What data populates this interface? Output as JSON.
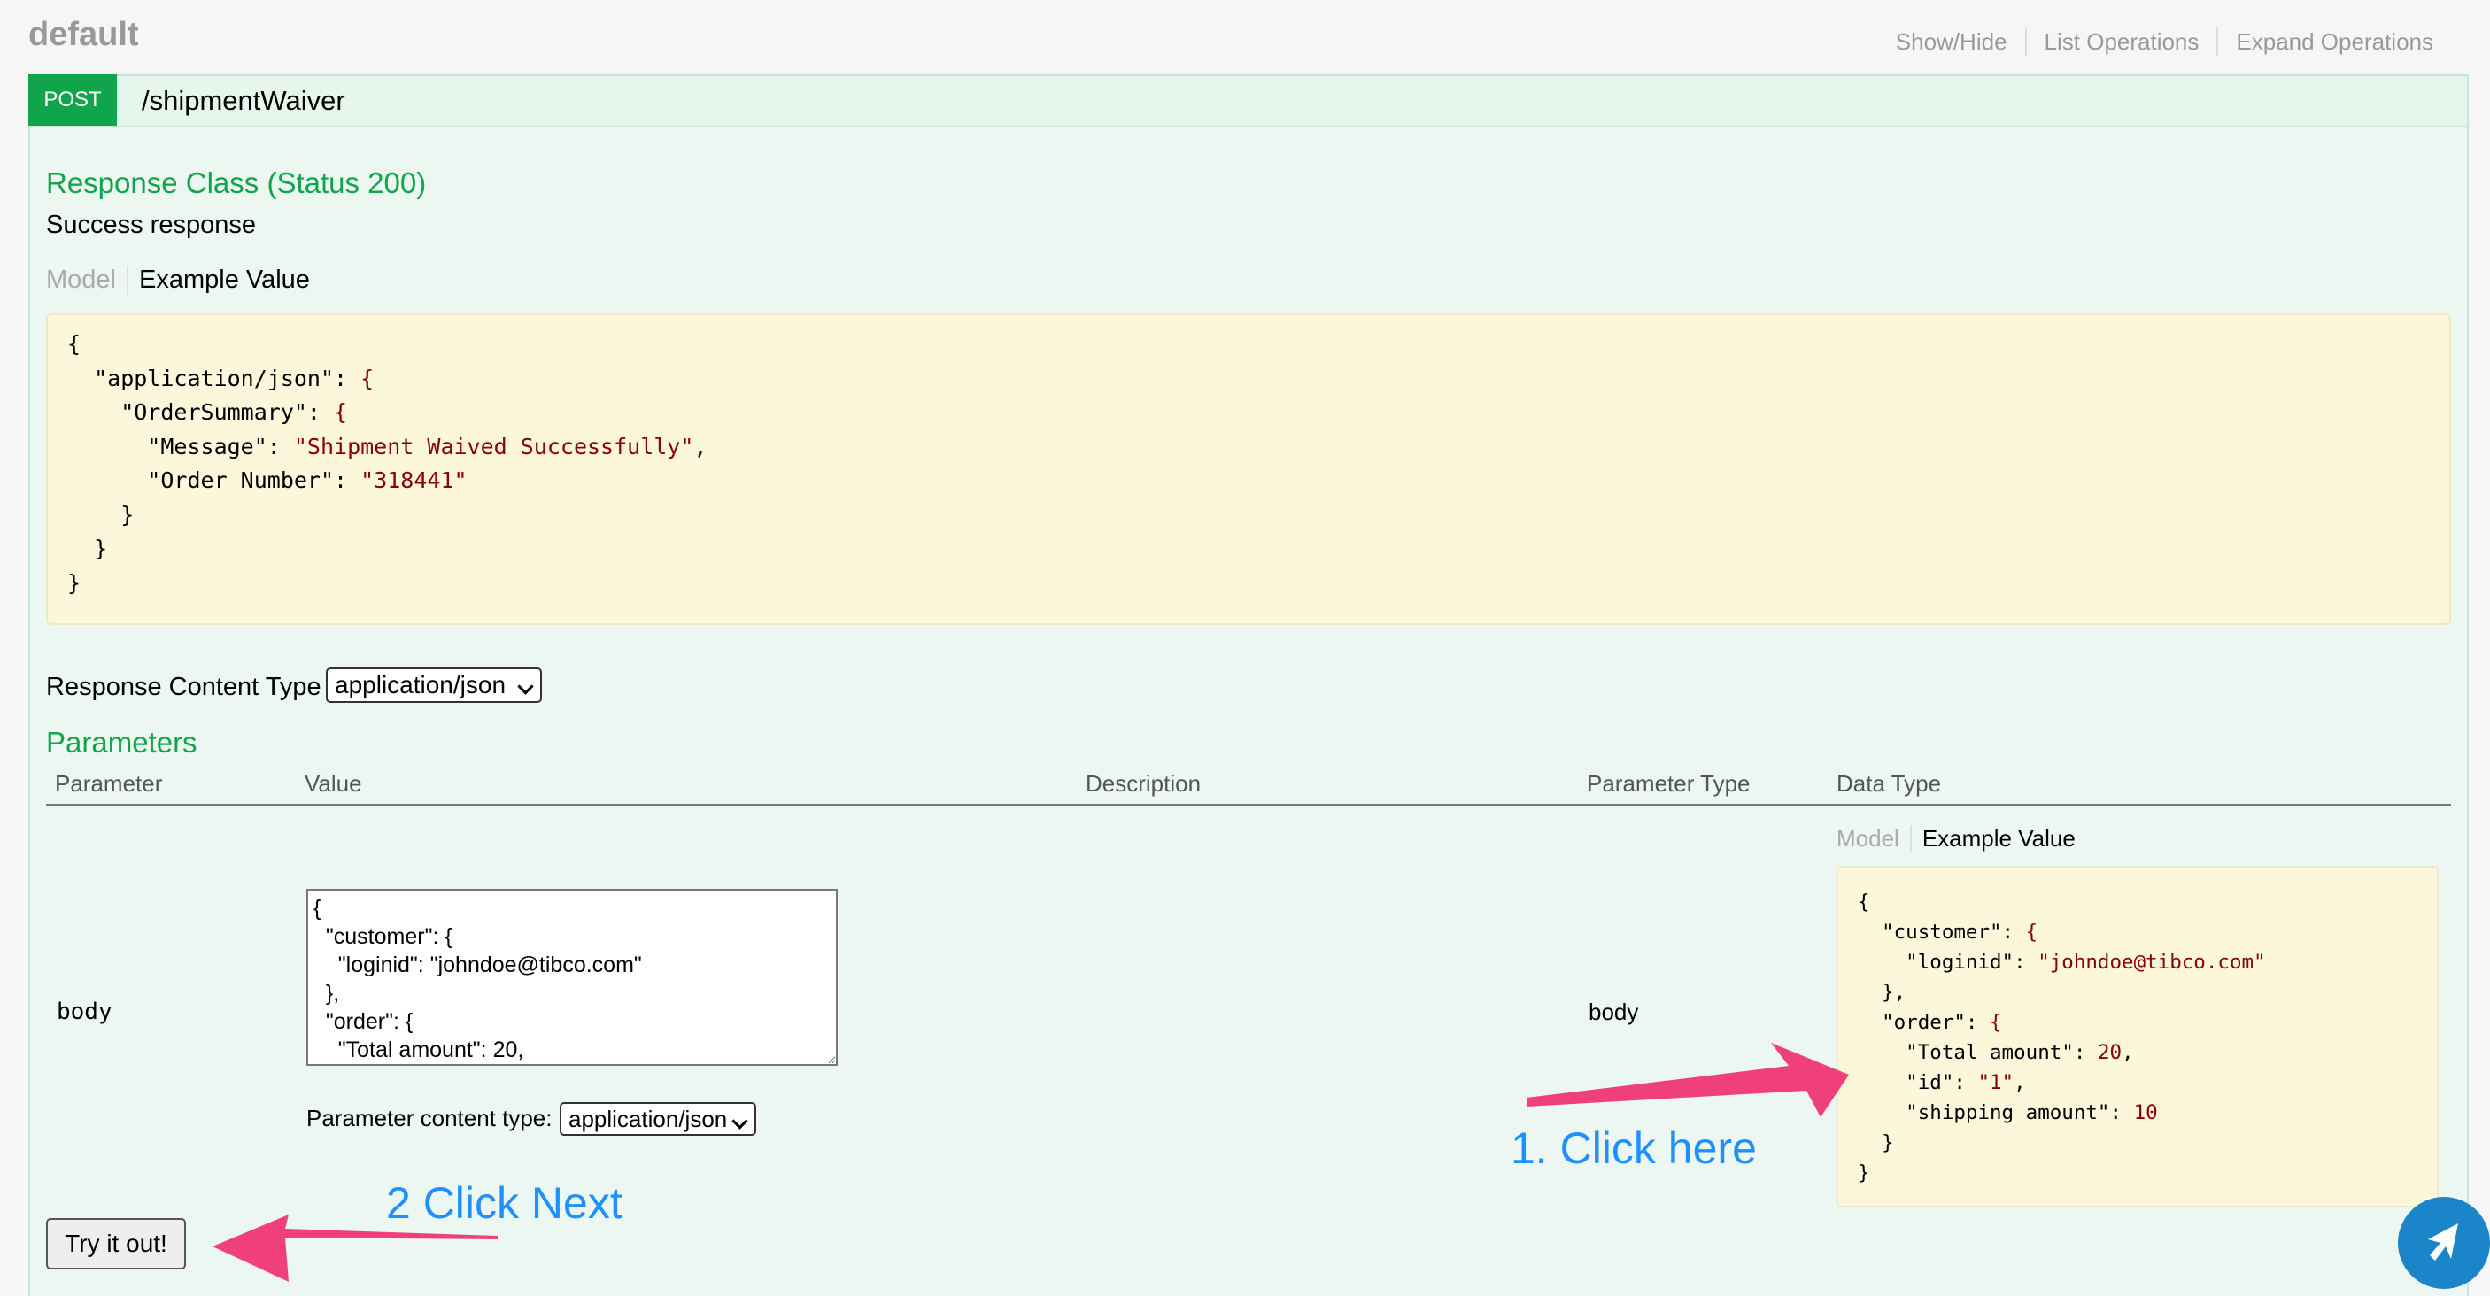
{
  "section_title": "default",
  "header_links": [
    "Show/Hide",
    "List Operations",
    "Expand Operations"
  ],
  "operation": {
    "method": "POST",
    "path": "/shipmentWaiver"
  },
  "response_class": {
    "heading": "Response Class (Status 200)",
    "description": "Success response",
    "tabs": {
      "model": "Model",
      "example": "Example Value"
    },
    "example_lines": [
      "{",
      "  \"application/json\": {",
      "    \"OrderSummary\": {",
      "      \"Message\": \"Shipment Waived Successfully\",",
      "      \"Order Number\": \"318441\"",
      "    }",
      "  }",
      "}"
    ]
  },
  "response_content_type": {
    "label": "Response Content Type",
    "selected": "application/json"
  },
  "parameters": {
    "heading": "Parameters",
    "columns": [
      "Parameter",
      "Value",
      "Description",
      "Parameter Type",
      "Data Type"
    ],
    "rows": [
      {
        "name": "body",
        "value_lines": [
          "{",
          "  \"customer\": {",
          "    \"loginid\": \"johndoe@tibco.com\"",
          "  },",
          "  \"order\": {",
          "    \"Total amount\": 20,"
        ],
        "content_type_label": "Parameter content type:",
        "content_type_selected": "application/json",
        "parameter_type": "body",
        "data_type_tabs": {
          "model": "Model",
          "example": "Example Value"
        },
        "example_lines": [
          "{",
          "  \"customer\": {",
          "    \"loginid\": \"johndoe@tibco.com\"",
          "  },",
          "  \"order\": {",
          "    \"Total amount\": 20,",
          "    \"id\": \"1\",",
          "    \"shipping amount\": 10",
          "  }",
          "}"
        ]
      }
    ]
  },
  "try_button_label": "Try it out!",
  "annotations": {
    "step1": "1. Click here",
    "step2": "2 Click Next"
  },
  "colors": {
    "accent_green": "#10a54a",
    "annotation_blue": "#1e90ff",
    "arrow_pink": "#f0407a",
    "help_blue": "#1a86c9"
  },
  "icons": {
    "help": "help-bubble-arrow-icon",
    "arrows": "pointer-arrow"
  }
}
